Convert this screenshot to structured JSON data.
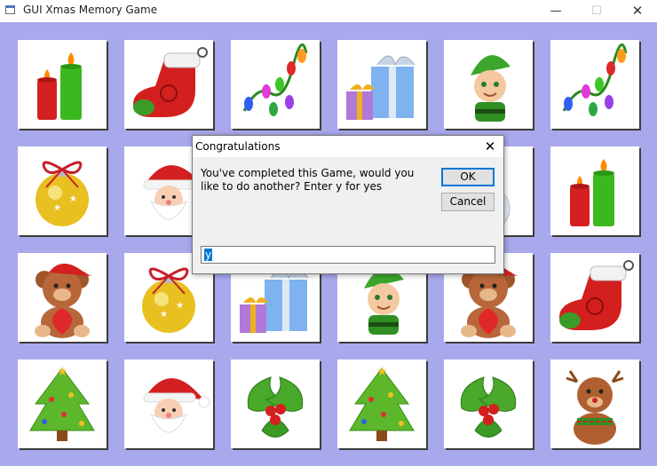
{
  "window": {
    "title": "GUI Xmas Memory Game",
    "minimize_glyph": "—",
    "maximize_glyph": "☐",
    "close_glyph": "✕"
  },
  "colors": {
    "board_background": "#a9a8ec",
    "card_background": "#ffffff",
    "dialog_background": "#f0f0f0"
  },
  "board": {
    "rows": [
      [
        "candles",
        "stocking",
        "lights",
        "gifts",
        "elf",
        "lights"
      ],
      [
        "bauble",
        "santa",
        "hidden",
        "hidden",
        "snowman",
        "candles"
      ],
      [
        "teddy",
        "bauble",
        "gifts",
        "elf",
        "teddy",
        "stocking"
      ],
      [
        "tree",
        "santa",
        "holly",
        "tree",
        "holly",
        "reindeer-teddy"
      ]
    ]
  },
  "dialog": {
    "title": "Congratulations",
    "close_glyph": "✕",
    "message": "You've completed this Game, would you like to do another? Enter y for yes",
    "ok_label": "OK",
    "cancel_label": "Cancel",
    "input_value": "y"
  }
}
